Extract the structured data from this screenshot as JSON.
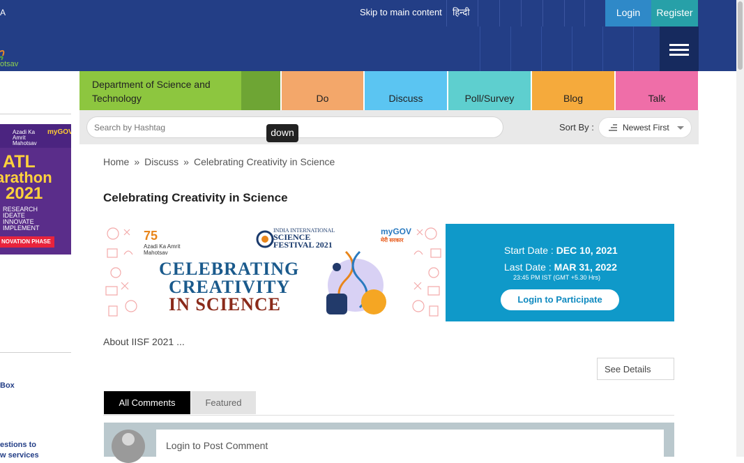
{
  "topbar": {
    "left_fragment": "A",
    "skip_link": "Skip to main content",
    "language": "हिन्दी",
    "login": "Login",
    "register": "Register"
  },
  "header": {
    "logo_fragment": "otsav",
    "menu_icon": "hamburger-icon"
  },
  "sidebar": {
    "banner": {
      "azadi": "Azadi Ka Amrit Mahotsav",
      "mygov": "myGOV",
      "title_line1": "ATL",
      "title_line2": "arathon",
      "title_line3": "2021",
      "lines": [
        "RESEARCH",
        "IDEATE",
        "INNOVATE",
        "IMPLEMENT"
      ],
      "phase": "NOVATION PHASE"
    },
    "link1": "Box",
    "link2_line1": "estions to",
    "link2_line2": "w services"
  },
  "categories": {
    "department": "Department of Science and Technology",
    "items": [
      {
        "label": "Do",
        "color": "#f3a76a"
      },
      {
        "label": "Discuss",
        "color": "#5bc5f2"
      },
      {
        "label": "Poll/Survey",
        "color": "#5ecfcf"
      },
      {
        "label": "Blog",
        "color": "#f5aa3c"
      },
      {
        "label": "Talk",
        "color": "#ef6ea8"
      }
    ]
  },
  "search": {
    "placeholder": "Search by Hashtag",
    "tooltip": "down",
    "sort_label": "Sort By :",
    "sort_value": "Newest First"
  },
  "breadcrumb": {
    "home": "Home",
    "sep": "»",
    "discuss": "Discuss",
    "current": "Celebrating Creativity in Science"
  },
  "page": {
    "title": "Celebrating Creativity in Science"
  },
  "hero": {
    "azadi_75": "75",
    "azadi_text": "Azadi Ka Amrit Mahotsav",
    "iisf_small": "INDIA INTERNATIONAL",
    "iisf_big": "SCIENCE FESTIVAL 2021",
    "mygov": "myGOV",
    "mygov_hindi": "मेरी सरकार",
    "line1": "CELEBRATING",
    "line2": "CREATIVITY",
    "line3": "IN SCIENCE"
  },
  "info": {
    "start_label": "Start Date :",
    "start_value": "DEC 10, 2021",
    "last_label": "Last Date :",
    "last_value": "MAR 31, 2022",
    "time_note": "23:45 PM IST (GMT +5.30 Hrs)",
    "login_btn": "Login to Participate"
  },
  "about": "About IISF 2021 ...",
  "see_details": "See Details",
  "tabs": {
    "all": "All Comments",
    "featured": "Featured"
  },
  "comment": {
    "placeholder": "Login to Post Comment"
  }
}
